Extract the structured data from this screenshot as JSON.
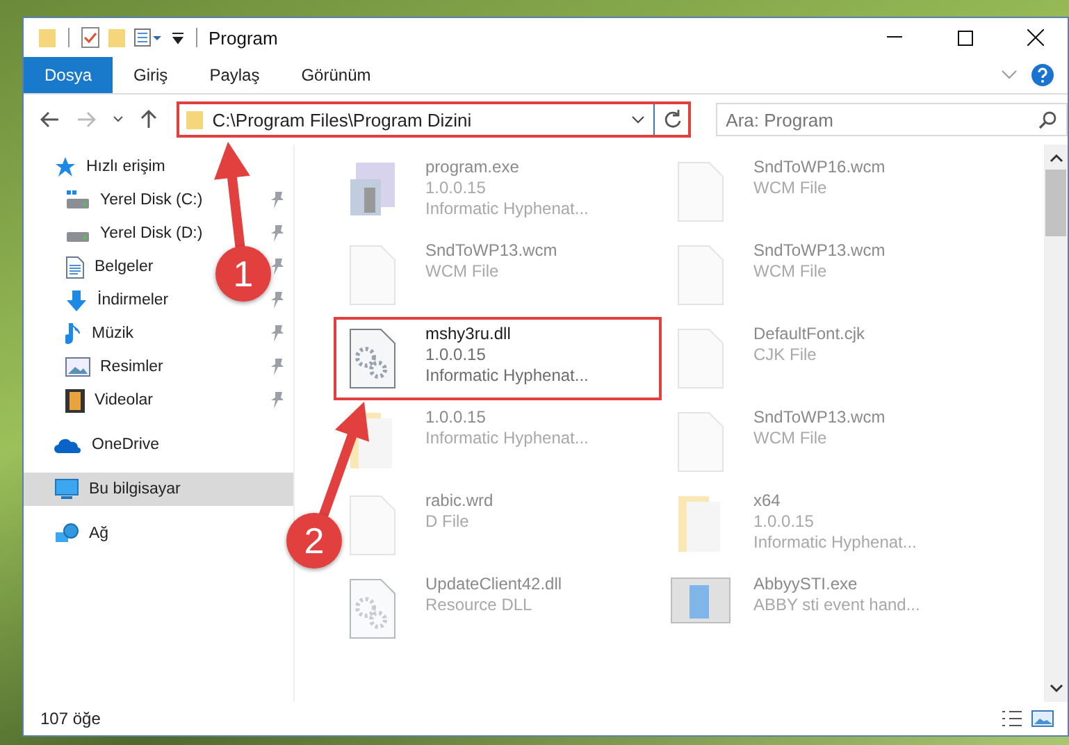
{
  "window": {
    "title": "Program"
  },
  "ribbon": {
    "tabs": [
      {
        "label": "Dosya",
        "selected": true
      },
      {
        "label": "Giriş",
        "selected": false
      },
      {
        "label": "Paylaş",
        "selected": false
      },
      {
        "label": "Görünüm",
        "selected": false
      }
    ]
  },
  "address": {
    "path": "C:\\Program Files\\Program Dizini",
    "highlighted": true
  },
  "search": {
    "placeholder": "Ara: Program"
  },
  "sidebar": {
    "items": [
      {
        "label": "Hızlı erişim",
        "kind": "star",
        "selected": false,
        "children": [
          {
            "label": "Yerel Disk (C:)",
            "kind": "drive-c",
            "pinned": true,
            "selected": false
          },
          {
            "label": "Yerel Disk (D:)",
            "kind": "drive",
            "pinned": true,
            "selected": false
          },
          {
            "label": "Belgeler",
            "kind": "document",
            "pinned": true,
            "selected": false
          },
          {
            "label": "İndirmeler",
            "kind": "download",
            "pinned": true,
            "selected": false
          },
          {
            "label": "Müzik",
            "kind": "music",
            "pinned": true,
            "selected": false
          },
          {
            "label": "Resimler",
            "kind": "picture",
            "pinned": true,
            "selected": false
          },
          {
            "label": "Videolar",
            "kind": "video",
            "pinned": true,
            "selected": false
          }
        ]
      },
      {
        "label": "OneDrive",
        "kind": "cloud",
        "selected": false
      },
      {
        "label": "Bu bilgisayar",
        "kind": "computer",
        "selected": true
      },
      {
        "label": "Ağ",
        "kind": "network",
        "selected": false
      }
    ]
  },
  "files": [
    {
      "kind": "exe",
      "lines": [
        "program.exe",
        "1.0.0.15",
        "Informatic Hyphenat..."
      ],
      "dimmed": true,
      "highlighted": false
    },
    {
      "kind": "blank",
      "lines": [
        "SndToWP16.wcm",
        "WCM File"
      ],
      "dimmed": true,
      "highlighted": false
    },
    {
      "kind": "blank",
      "lines": [
        "SndToWP13.wcm",
        "WCM File"
      ],
      "dimmed": true,
      "highlighted": false
    },
    {
      "kind": "blank",
      "lines": [
        "SndToWP13.wcm",
        "WCM File"
      ],
      "dimmed": true,
      "highlighted": false
    },
    {
      "kind": "dll",
      "lines": [
        "mshy3ru.dll",
        "1.0.0.15",
        "Informatic Hyphenat..."
      ],
      "dimmed": false,
      "highlighted": true
    },
    {
      "kind": "blank",
      "lines": [
        "DefaultFont.cjk",
        "CJK File"
      ],
      "dimmed": true,
      "highlighted": false
    },
    {
      "kind": "folder",
      "lines": [
        "1.0.0.15",
        "Informatic Hyphenat..."
      ],
      "dimmed": true,
      "highlighted": false
    },
    {
      "kind": "blank",
      "lines": [
        "SndToWP13.wcm",
        "WCM File"
      ],
      "dimmed": true,
      "highlighted": false
    },
    {
      "kind": "blank",
      "lines": [
        "rabic.wrd",
        "D File"
      ],
      "dimmed": true,
      "highlighted": false
    },
    {
      "kind": "folder",
      "lines": [
        "x64",
        "1.0.0.15",
        "Informatic Hyphenat..."
      ],
      "dimmed": true,
      "highlighted": false
    },
    {
      "kind": "dll",
      "lines": [
        "UpdateClient42.dll",
        "Resource DLL"
      ],
      "dimmed": true,
      "highlighted": false
    },
    {
      "kind": "app",
      "lines": [
        "AbbyySTI.exe",
        "ABBY sti event hand..."
      ],
      "dimmed": true,
      "highlighted": false
    }
  ],
  "status_bar": {
    "count": "107 öğe"
  },
  "annotations": [
    {
      "number": "1"
    },
    {
      "number": "2"
    }
  ]
}
